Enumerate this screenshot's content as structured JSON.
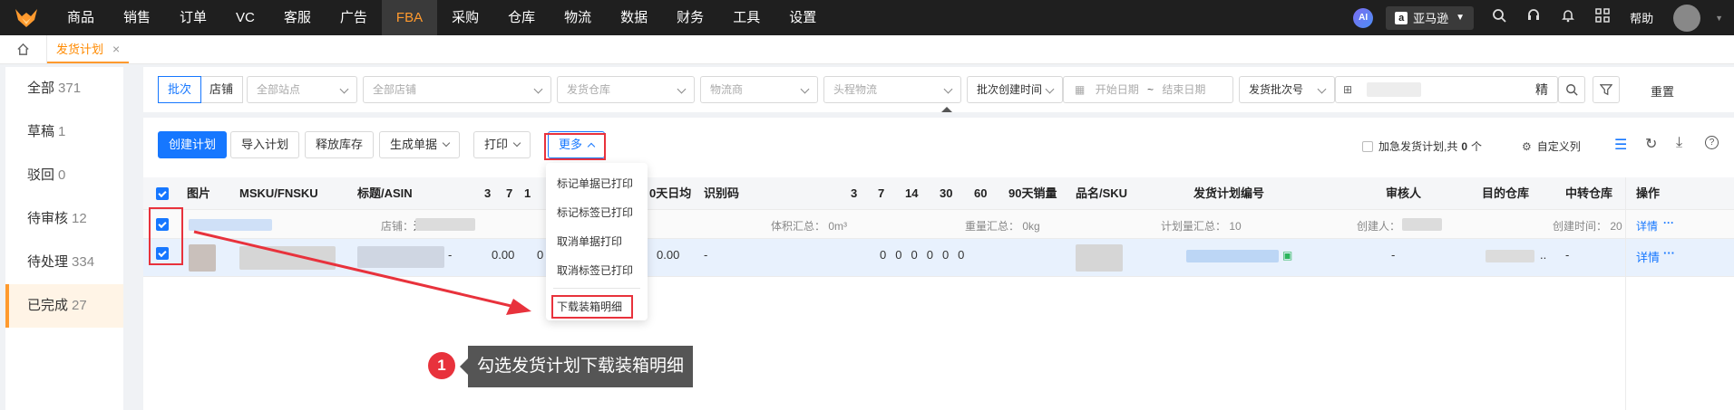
{
  "nav": {
    "items": [
      "商品",
      "销售",
      "订单",
      "VC",
      "客服",
      "广告",
      "FBA",
      "采购",
      "仓库",
      "物流",
      "数据",
      "财务",
      "工具",
      "设置"
    ],
    "active": "FBA",
    "ai_label": "AI",
    "store_label": "亚马逊",
    "store_icon": "amazon-icon",
    "help_label": "帮助"
  },
  "tabs": {
    "home_icon": "home-icon",
    "current": "发货计划",
    "close_symbol": "×"
  },
  "status_list": [
    {
      "label": "全部",
      "count": "371"
    },
    {
      "label": "草稿",
      "count": "1"
    },
    {
      "label": "驳回",
      "count": "0"
    },
    {
      "label": "待审核",
      "count": "12"
    },
    {
      "label": "待处理",
      "count": "334"
    },
    {
      "label": "已完成",
      "count": "27"
    }
  ],
  "status_active": "已完成",
  "filters": {
    "seg_batch": "批次",
    "seg_store": "店铺",
    "all_sites": "全部站点",
    "all_stores": "全部店铺",
    "ship_warehouse": "发货仓库",
    "carrier": "物流商",
    "first_leg": "头程物流",
    "time_type": "批次创建时间",
    "start_date": "开始日期",
    "range_sep": "~",
    "end_date": "结束日期",
    "batch_no": "发货批次号",
    "search_mode": "精",
    "reset": "重置"
  },
  "toolbar": {
    "create": "创建计划",
    "import": "导入计划",
    "release": "释放库存",
    "generate": "生成单据",
    "print": "打印",
    "more": "更多",
    "urgent_label": "加急发货计划,共",
    "urgent_count": "0",
    "urgent_unit": "个",
    "custom_cols": "自定义列"
  },
  "table": {
    "headers": {
      "image": "图片",
      "msku": "MSKU/FNSKU",
      "title": "标题/ASIN",
      "d3": "3",
      "d7": "7",
      "d1x": "1",
      "avg30": "0天日均",
      "idcode": "识别码",
      "s3": "3",
      "s7": "7",
      "s14": "14",
      "s30": "30",
      "s60": "60",
      "s90": "90天销量",
      "sku": "品名/SKU",
      "plan_no": "发货计划编号",
      "auditor": "审核人",
      "dest_wh": "目的仓库",
      "transit_wh": "中转仓库",
      "ops": "操作"
    },
    "group": {
      "store_label": "店铺：",
      "store_value": "辽",
      "volume": "体积汇总： 0m³",
      "weight": "重量汇总： 0kg",
      "plan_qty": "计划量汇总： 10",
      "creator": "创建人：",
      "created_at": "创建时间： 20",
      "detail": "详情",
      "more": "···"
    },
    "row": {
      "dash_left": "-",
      "v1": "0.00",
      "v2": "0",
      "v3": "0.00",
      "idcode": "-",
      "sales": [
        "0",
        "0",
        "0",
        "0",
        "0",
        "0"
      ],
      "auditor": "-",
      "dest_suffix": "..",
      "transit": "-",
      "detail": "详情",
      "more": "···"
    }
  },
  "dropdown": {
    "items": [
      "标记单据已打印",
      "标记标签已打印",
      "取消单据打印",
      "取消标签已打印"
    ],
    "download": "下载装箱明细"
  },
  "annotation": {
    "step": "1",
    "tip": "勾选发货计划下载装箱明细",
    "color": "#e8323c"
  },
  "colors": {
    "primary": "#1677ff",
    "accent": "#ff9a2e",
    "nav_bg": "#1f1f1f"
  }
}
